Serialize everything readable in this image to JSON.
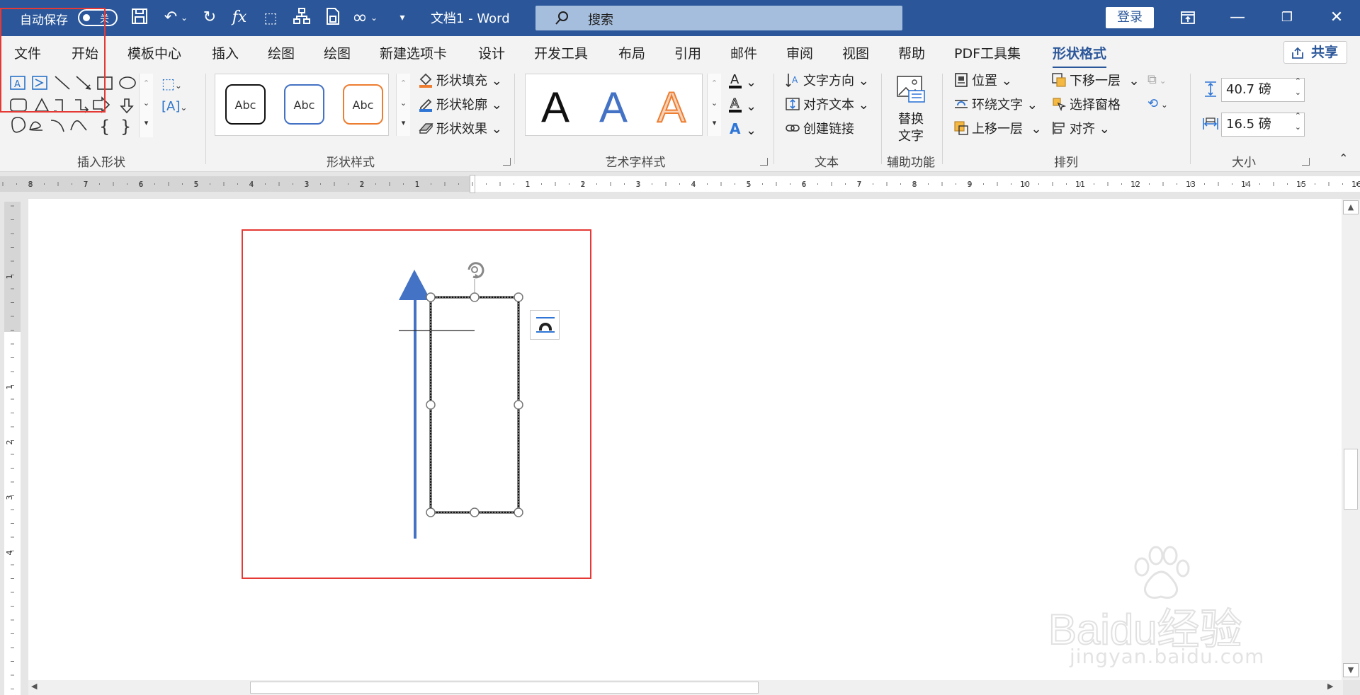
{
  "titlebar": {
    "autosave_label": "自动保存",
    "autosave_state": "关",
    "doc_title": "文档1  -  Word",
    "search_placeholder": "搜索",
    "login_label": "登录",
    "qat_icons": [
      "save-icon",
      "undo-icon",
      "redo-icon",
      "function-icon",
      "select-icon",
      "org-chart-icon",
      "document-icon",
      "infinity-icon",
      "customize-qat-icon"
    ]
  },
  "tabs": [
    "文件",
    "开始",
    "模板中心",
    "插入",
    "绘图",
    "绘图",
    "新建选项卡",
    "设计",
    "开发工具",
    "布局",
    "引用",
    "邮件",
    "审阅",
    "视图",
    "帮助",
    "PDF工具集",
    "形状格式"
  ],
  "active_tab": "形状格式",
  "share_label": "共享",
  "ribbon": {
    "insert_shapes": {
      "label": "插入形状"
    },
    "shape_styles": {
      "label": "形状样式",
      "previews": [
        "Abc",
        "Abc",
        "Abc"
      ],
      "fill": "形状填充",
      "outline": "形状轮廓",
      "effects": "形状效果"
    },
    "wordart": {
      "label": "艺术字样式",
      "letters": [
        "A",
        "A",
        "A"
      ]
    },
    "text": {
      "label": "文本",
      "direction": "文字方向",
      "align": "对齐文本",
      "link": "创建链接"
    },
    "accessibility": {
      "label": "辅助功能",
      "alt_text_line1": "替换",
      "alt_text_line2": "文字"
    },
    "arrange": {
      "label": "排列",
      "position": "位置",
      "wrap": "环绕文字",
      "bring_forward": "上移一层",
      "send_backward": "下移一层",
      "selection_pane": "选择窗格",
      "align": "对齐"
    },
    "size": {
      "label": "大小",
      "height": "40.7 磅",
      "width": "16.5 磅"
    }
  },
  "ruler_numbers": [
    "8",
    "7",
    "6",
    "5",
    "4",
    "3",
    "2",
    "1",
    "1",
    "2",
    "3",
    "4",
    "5",
    "6",
    "7",
    "8",
    "9",
    "10",
    "11",
    "12",
    "13",
    "14",
    "15",
    "16"
  ],
  "vruler_numbers": [
    "1",
    "1",
    "2",
    "3",
    "4"
  ],
  "watermark": {
    "brand": "Baidu经验",
    "url": "jingyan.baidu.com"
  },
  "colors": {
    "brand": "#2b579a",
    "arrow": "#4472c4",
    "highlight": "#e53935"
  }
}
